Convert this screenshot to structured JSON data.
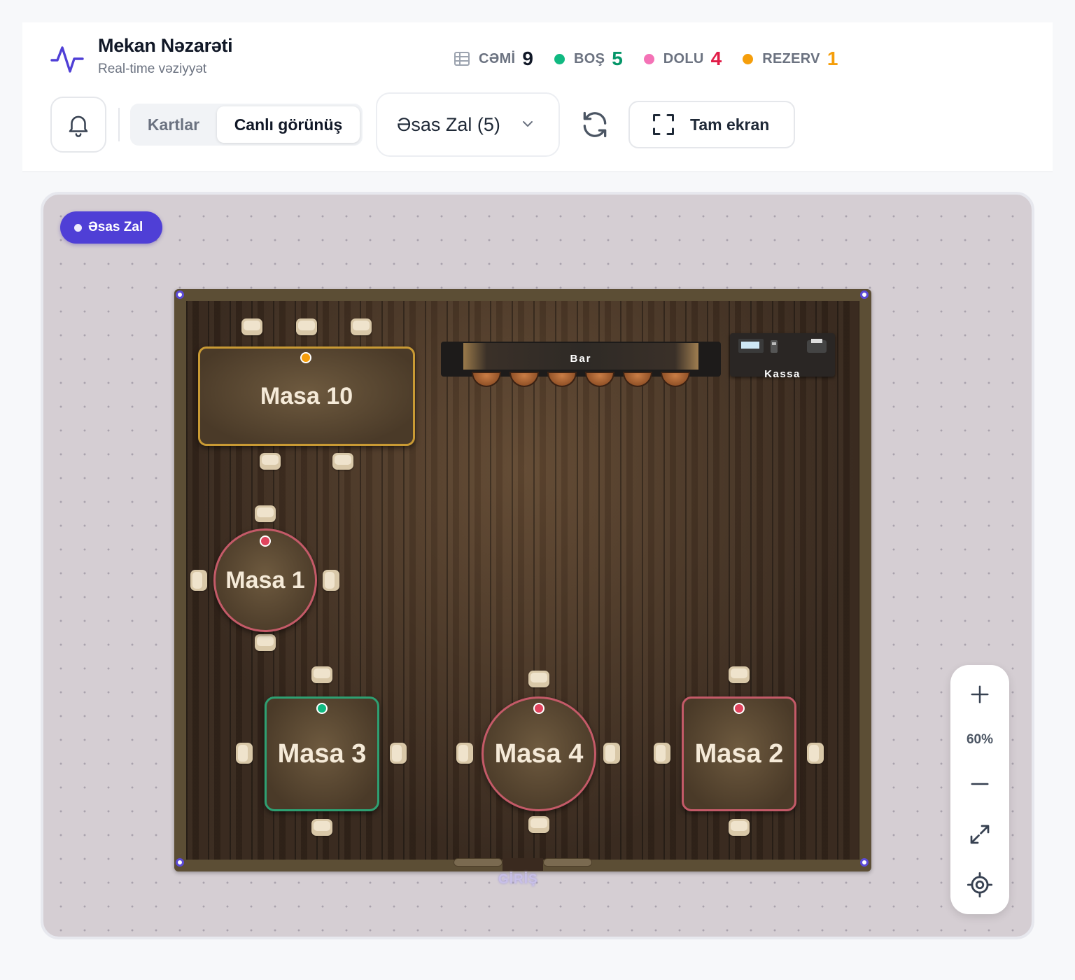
{
  "header": {
    "title": "Mekan Nəzarəti",
    "subtitle": "Real-time vəziyyət",
    "icon": "activity-icon"
  },
  "stats": [
    {
      "label": "CƏMİ",
      "value": "9",
      "color": "#111827",
      "dot": "#6b7280",
      "icon": "table-grid-icon"
    },
    {
      "label": "BOŞ",
      "value": "5",
      "color": "#059669",
      "dot": "#10b981"
    },
    {
      "label": "DOLU",
      "value": "4",
      "color": "#e11d48",
      "dot": "#f472b6"
    },
    {
      "label": "REZERV",
      "value": "1",
      "color": "#f59e0b",
      "dot": "#f59e0b"
    }
  ],
  "toolbar": {
    "view_cards": "Kartlar",
    "view_live": "Canlı görünüş",
    "hall_select": "Əsas Zal (5)",
    "fullscreen": "Tam ekran"
  },
  "floor": {
    "hall_badge": "Əsas Zal",
    "entrance": "GİRİŞ",
    "bar_label": "Bar",
    "kassa_label": "Kassa",
    "tables": [
      {
        "name": "Masa 10",
        "status": "reserved",
        "color": "#f59e0b"
      },
      {
        "name": "Masa 1",
        "status": "occupied",
        "color": "#e0445e"
      },
      {
        "name": "Masa 3",
        "status": "free",
        "color": "#10b981"
      },
      {
        "name": "Masa 4",
        "status": "occupied",
        "color": "#e0445e"
      },
      {
        "name": "Masa 2",
        "status": "occupied",
        "color": "#e0445e"
      }
    ]
  },
  "zoom": {
    "level": "60%"
  },
  "colors": {
    "accent": "#4f3fd6",
    "free": "#10b981",
    "occupied": "#e0445e",
    "reserved": "#f59e0b"
  }
}
